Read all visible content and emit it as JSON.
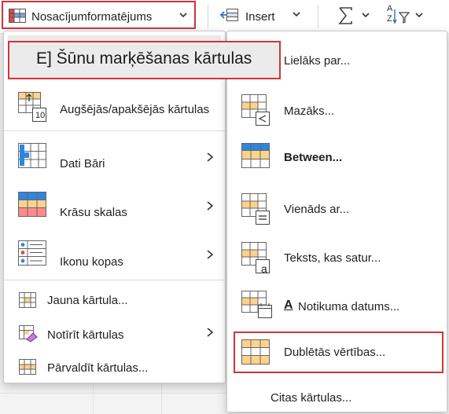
{
  "ribbon": {
    "conditional_formatting_label": "Nosacījumformatējums",
    "insert_label": "Insert",
    "sort_letters_top": "A",
    "sort_letters_bottom": "Z"
  },
  "left_menu": {
    "items": [
      {
        "label": "E] Šūnu marķēšanas kārtulas",
        "has_submenu": true
      },
      {
        "label": "Augšējās/apakšējās kārtulas",
        "has_submenu": false,
        "icon_number": "10"
      },
      {
        "label": "Dati    Bāri",
        "has_submenu": true
      },
      {
        "label": "Krāsu skalas",
        "has_submenu": true
      },
      {
        "label": "Ikonu kopas",
        "has_submenu": true
      },
      {
        "label": "Jauna kārtula...",
        "has_submenu": false
      },
      {
        "label": "Notīrīt kārtulas",
        "has_submenu": true
      },
      {
        "label": "Pārvaldīt kārtulas...",
        "has_submenu": false
      }
    ]
  },
  "right_menu": {
    "items": [
      {
        "label": "Lielāks par...",
        "symbol": ">"
      },
      {
        "label": "Mazāks...",
        "symbol": "<"
      },
      {
        "label": "Between...",
        "symbol": ""
      },
      {
        "label": "Vienāds ar...",
        "symbol": "="
      },
      {
        "label": "Teksts, kas satur...",
        "symbol": "a"
      },
      {
        "label": "Notikuma datums...",
        "symbol": "A"
      },
      {
        "label": "Dublētās vērtības...",
        "symbol": ""
      },
      {
        "label": "Citas kārtulas...",
        "symbol": ""
      }
    ]
  },
  "colors": {
    "highlight_border": "#d13438",
    "orange_fill": "#ffd28c",
    "orange_border": "#e8a23a",
    "blue": "#2e86de",
    "red_fill": "#ff8a8a"
  }
}
